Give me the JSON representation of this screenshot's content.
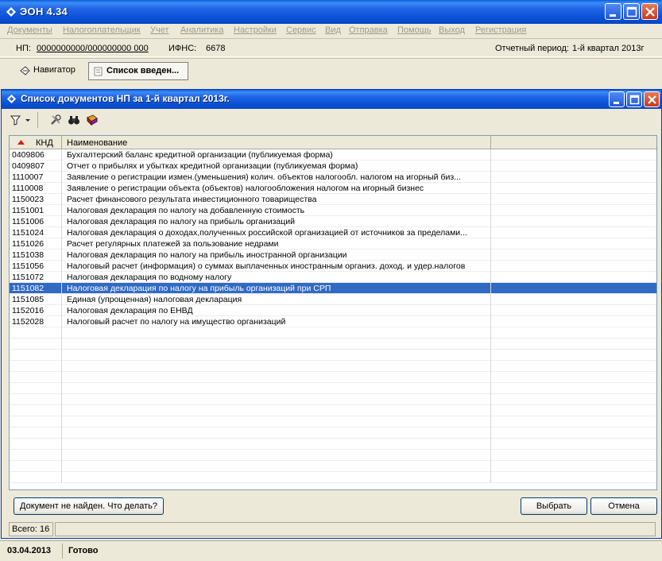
{
  "window": {
    "title": "ЭОН 4.34"
  },
  "menu": [
    "Документы",
    "Налогоплательщик",
    "Учет",
    "Аналитика",
    "Настройки",
    "Сервис",
    "Вид",
    "Отправка",
    "Помощь",
    "Выход",
    "Регистрация"
  ],
  "info": {
    "np_label": "НП:",
    "np_value": "0000000000/000000000 000",
    "ifns_label": "ИФНС:",
    "ifns_value": "6678",
    "period_label": "Отчетный период:",
    "period_value": "1-й квартал  2013г"
  },
  "tabs": {
    "navigator": "Навигатор",
    "list": "Список введен..."
  },
  "child": {
    "title": "Список документов НП за 1-й квартал 2013г.",
    "grid": {
      "col_knd": "КНД",
      "col_name": "Наименование",
      "rows": [
        {
          "knd": "0409806",
          "name": "Бухгалтерский баланс кредитной организации  (публикуемая форма)"
        },
        {
          "knd": "0409807",
          "name": "Отчет о прибылях и убытках кредитной организации (публикуемая форма)"
        },
        {
          "knd": "1110007",
          "name": "Заявление о регистрации измен.(уменьшения) колич. объектов  налогообл. налогом на игорный биз..."
        },
        {
          "knd": "1110008",
          "name": "Заявление о регистрации объекта (объектов) налогообложения налогом на игорный бизнес"
        },
        {
          "knd": "1150023",
          "name": "Расчет финансового результата инвестиционного товарищества"
        },
        {
          "knd": "1151001",
          "name": "Налоговая декларация по налогу на добавленную стоимость"
        },
        {
          "knd": "1151006",
          "name": "Налоговая декларация по налогу на прибыль организаций"
        },
        {
          "knd": "1151024",
          "name": "Налоговая декларация о доходах,полученных российской организацией от источников за пределами..."
        },
        {
          "knd": "1151026",
          "name": "Расчет регулярных платежей за пользование недрами"
        },
        {
          "knd": "1151038",
          "name": "Налоговая декларация по налогу на прибыль иностранной организации"
        },
        {
          "knd": "1151056",
          "name": "Налоговый расчет (информация) о суммах выплаченных иностранным организ. доход. и удер.налогов"
        },
        {
          "knd": "1151072",
          "name": "Налоговая декларация по водному налогу"
        },
        {
          "knd": "1151082",
          "name": "Налоговая декларация по налогу на прибыль организаций при СРП"
        },
        {
          "knd": "1151085",
          "name": "Единая (упрощенная) налоговая декларация"
        },
        {
          "knd": "1152016",
          "name": "Налоговая декларация по ЕНВД"
        },
        {
          "knd": "1152028",
          "name": "Налоговый расчет по налогу на имущество организаций"
        }
      ],
      "selected_index": 12
    },
    "buttons": {
      "not_found": "Документ не найден. Что делать?",
      "select": "Выбрать",
      "cancel": "Отмена"
    },
    "count_text": "Всего: 16"
  },
  "status": {
    "date": "03.04.2013",
    "state": "Готово"
  },
  "colors": {
    "titlebar": "#0A53D8",
    "selection": "#316AC5",
    "close": "#C7391A"
  }
}
